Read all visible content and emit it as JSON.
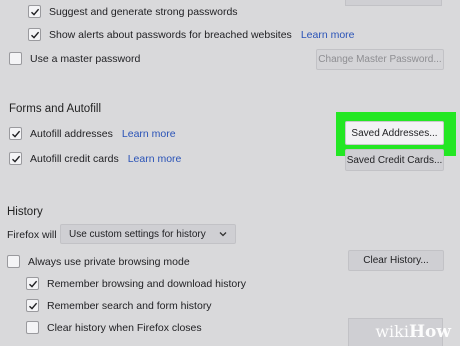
{
  "passwords": {
    "suggest_label": "Suggest and generate strong passwords",
    "alerts_label": "Show alerts about passwords for breached websites",
    "alerts_link": "Learn more",
    "master_label": "Use a master password",
    "change_master_button": "Change Master Password..."
  },
  "forms": {
    "title": "Forms and Autofill",
    "addresses_label": "Autofill addresses",
    "addresses_link": "Learn more",
    "saved_addresses_button": "Saved Addresses...",
    "cards_label": "Autofill credit cards",
    "cards_link": "Learn more",
    "saved_cards_button": "Saved Credit Cards..."
  },
  "history": {
    "title": "History",
    "will_label": "Firefox will",
    "select_value": "Use custom settings for history",
    "private_label": "Always use private browsing mode",
    "clear_history_button": "Clear History...",
    "browsing_label": "Remember browsing and download history",
    "search_label": "Remember search and form history",
    "clear_on_close_label": "Clear history when Firefox closes"
  },
  "watermark": {
    "wiki": "wiki",
    "how": "How"
  },
  "colors": {
    "highlight": "#23e723",
    "link": "#2a53b7",
    "background": "#d9d9db"
  }
}
